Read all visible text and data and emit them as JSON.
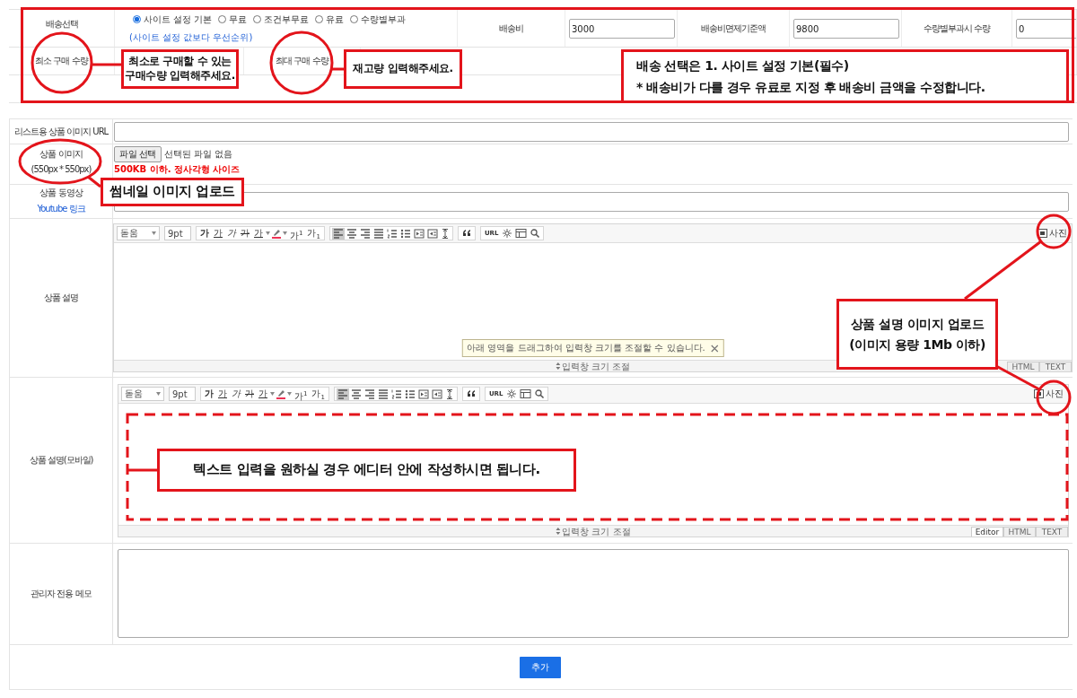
{
  "shipping": {
    "label": "배송선택",
    "options": [
      {
        "label": "사이트 설정 기본",
        "selected": true
      },
      {
        "label": "무료",
        "selected": false
      },
      {
        "label": "조건부무료",
        "selected": false
      },
      {
        "label": "유료",
        "selected": false
      },
      {
        "label": "수량별부과",
        "selected": false
      }
    ],
    "note": "(사이트 설정 값보다 우선순위)",
    "fields": [
      {
        "label": "배송비",
        "value": "3000"
      },
      {
        "label": "배송비면제기준액",
        "value": "9800"
      },
      {
        "label": "수량별부과시 수량",
        "value": "0"
      }
    ]
  },
  "quantity": {
    "min_label": "최소 구매 수량",
    "max_label": "최대 구매 수량"
  },
  "product": {
    "image_url_label": "리스트용 상품 이미지 URL",
    "image_label": "상품 이미지",
    "image_size": "(550px * 550px)",
    "file_button": "파일 선택",
    "file_status": "선택된 파일 없음",
    "image_hint": "500KB 이하. 정사각형 사이즈",
    "video_label": "상품 동영상",
    "video_link": "Youtube 링크"
  },
  "editors": [
    {
      "label": "상품 설명",
      "font": "돋움",
      "size": "9pt",
      "style_buttons": [
        {
          "kind": "bold",
          "label": "가"
        },
        {
          "kind": "underline",
          "label": "가"
        },
        {
          "kind": "italic",
          "label": "가"
        },
        {
          "kind": "strike",
          "label": "가"
        },
        {
          "kind": "color",
          "label": "가"
        },
        {
          "kind": "sup",
          "label": "가$^{1}$"
        },
        {
          "kind": "sub",
          "label": "가$_{1}$"
        }
      ],
      "align_buttons": [
        {
          "kind": "left",
          "selected": true
        },
        {
          "kind": "center",
          "selected": false
        },
        {
          "kind": "right",
          "selected": false
        },
        {
          "kind": "justify",
          "selected": false
        }
      ],
      "url_button": "URL",
      "photo_button": "사진",
      "tooltip": "아래 영역을 드래그하여 입력창 크기를 조절할 수 있습니다.",
      "resize": "입력창 크기 조절",
      "tabs": [
        {
          "label": "HTML",
          "selected": false
        },
        {
          "label": "TEXT",
          "selected": false
        }
      ]
    },
    {
      "label": "상품 설명(모바일)",
      "font": "돋움",
      "size": "9pt",
      "style_buttons": [
        {
          "kind": "bold",
          "label": "가"
        },
        {
          "kind": "underline",
          "label": "가"
        },
        {
          "kind": "italic",
          "label": "가"
        },
        {
          "kind": "strike",
          "label": "가"
        },
        {
          "kind": "color",
          "label": "가"
        },
        {
          "kind": "sup",
          "label": "가$^{1}$"
        },
        {
          "kind": "sub",
          "label": "가$_{1}$"
        }
      ],
      "align_buttons": [
        {
          "kind": "left",
          "selected": true
        },
        {
          "kind": "center",
          "selected": false
        },
        {
          "kind": "right",
          "selected": false
        },
        {
          "kind": "justify",
          "selected": false
        }
      ],
      "url_button": "URL",
      "photo_button": "사진",
      "resize": "입력창 크기 조절",
      "tabs": [
        {
          "label": "Editor",
          "selected": true
        },
        {
          "label": "HTML",
          "selected": false
        },
        {
          "label": "TEXT",
          "selected": false
        }
      ]
    }
  ],
  "memo": {
    "label": "관리자 전용 메모"
  },
  "submit": "추가",
  "annotations": {
    "callouts": [
      {
        "texts": [
          "최소로 구매할 수 있는\n구매수량 입력해주세요."
        ]
      },
      {
        "texts": [
          "재고량 입력해주세요."
        ]
      },
      {
        "texts": [
          "배송 선택은 1. 사이트 설정 기본(필수)",
          "* 배송비가 다를 경우 유료로 지정 후 배송비 금액을 수정합니다."
        ]
      },
      {
        "texts": [
          "썸네일 이미지 업로드"
        ]
      },
      {
        "texts": [
          "상품 설명 이미지 업로드",
          "(이미지 용량 1Mb 이하)"
        ]
      },
      {
        "texts": [
          "텍스트 입력을 원하실 경우 에디터 안에 작성하시면 됩니다."
        ]
      }
    ]
  }
}
